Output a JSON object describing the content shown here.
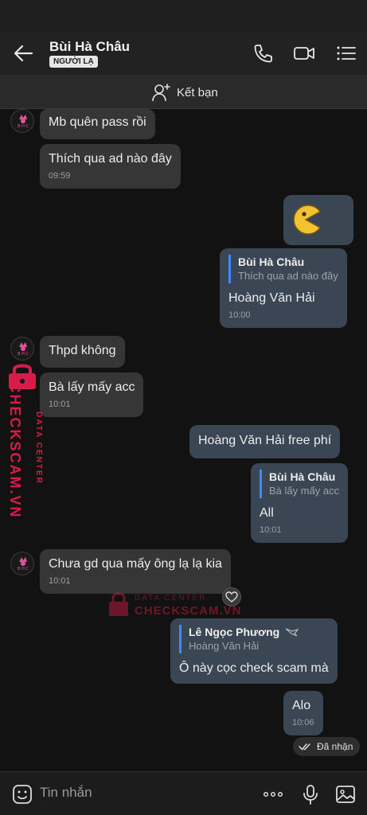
{
  "header": {
    "title": "Bùi Hà Châu",
    "badge": "NGƯỜI LẠ"
  },
  "add_friend": {
    "label": "Kết bạn"
  },
  "messages": [
    {
      "text": "Mb  quên pass rồi"
    },
    {
      "text": "Thích qua ad nào đây",
      "time": "09:59"
    },
    {
      "sticker": "pacman-sticker"
    },
    {
      "reply_name": "Bùi Hà Châu",
      "reply_snippet": "Thích qua ad nào đây",
      "text": "Hoàng Văn Hải",
      "time": "10:00"
    },
    {
      "text": "Thpd không"
    },
    {
      "text": "Bà lấy mấy acc",
      "time": "10:01"
    },
    {
      "text": "Hoàng Văn Hải free phí"
    },
    {
      "reply_name": "Bùi Hà Châu",
      "reply_snippet": "Bà lấy mấy acc",
      "text": "All",
      "time": "10:01"
    },
    {
      "text": "Chưa gd qua mấy ông lạ lạ kia",
      "time": "10:01"
    },
    {
      "reply_name": "Lê Ngọc Phương",
      "reply_snippet": "Hoàng Văn Hải",
      "text": "Ô này cọc check scam mà"
    },
    {
      "text": "Alo",
      "time": "10:06"
    }
  ],
  "delivery_status": "Đã nhận",
  "watermark": {
    "line1": "DATA CENTER",
    "line2": "CHECKSCAM.VN"
  },
  "input": {
    "placeholder": "Tin nhắn"
  },
  "colors": {
    "incoming_bubble": "#363636",
    "outgoing_bubble": "#3a4654",
    "reply_accent": "#3d8bff",
    "watermark": "#d81b4a"
  },
  "icons": {
    "back": "arrow-left-icon",
    "call": "phone-icon",
    "video": "video-camera-icon",
    "menu": "list-menu-icon",
    "add_friend": "person-add-icon",
    "emoji": "emoji-icon",
    "more": "more-dots-icon",
    "mic": "microphone-icon",
    "image": "image-icon"
  }
}
